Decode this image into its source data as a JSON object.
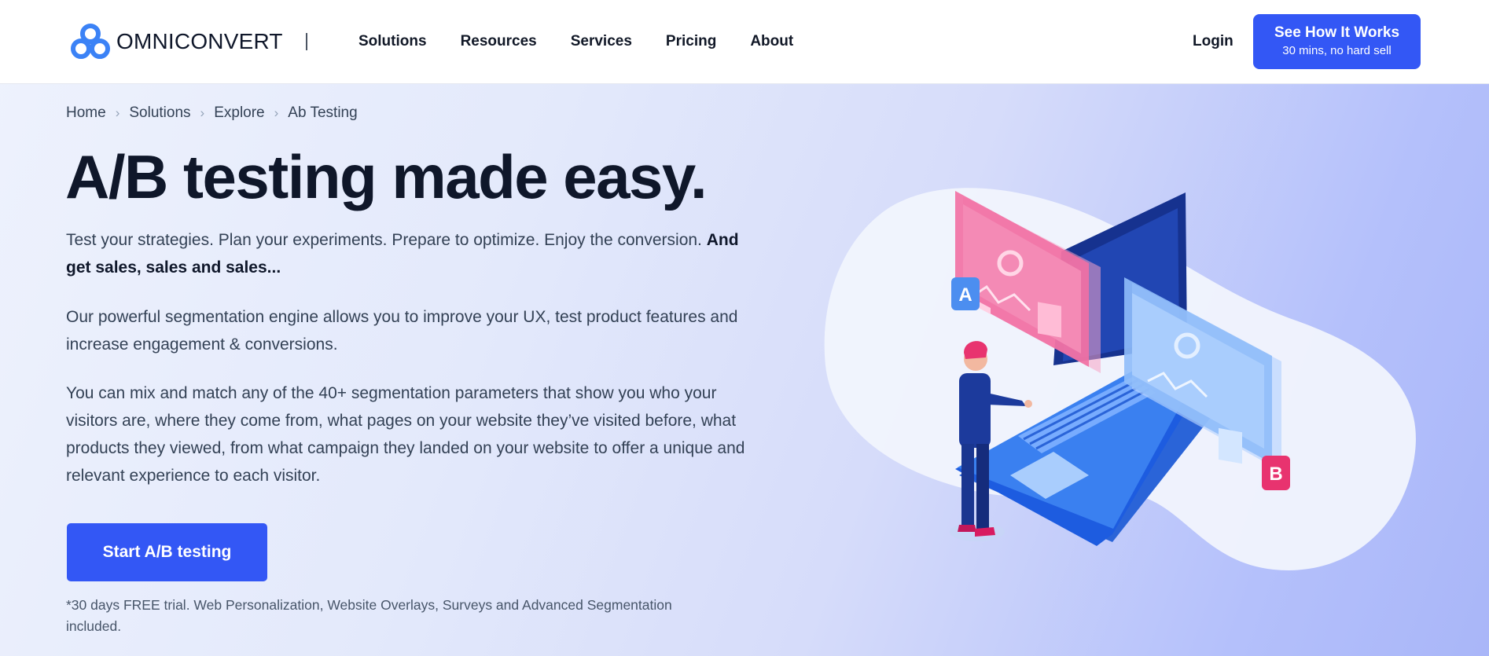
{
  "header": {
    "logo_text": "OMNICONVERT",
    "nav": [
      "Solutions",
      "Resources",
      "Services",
      "Pricing",
      "About"
    ],
    "login_label": "Login",
    "cta": {
      "title": "See How It Works",
      "subtitle": "30 mins, no hard sell"
    }
  },
  "breadcrumb": [
    "Home",
    "Solutions",
    "Explore",
    "Ab Testing"
  ],
  "hero": {
    "title": "A/B testing made easy.",
    "p1_text": "Test your strategies. Plan your experiments. Prepare to optimize. Enjoy the conversion. ",
    "p1_bold": "And get sales, sales and sales...",
    "p2": "Our powerful segmentation engine allows you to improve your UX, test product features and increase engagement & conversions.",
    "p3": "You can mix and match any of the 40+ segmentation parameters that show you who your visitors are, where they come from, what pages on your website they’ve visited before, what products they viewed, from what campaign they landed on your website to offer a unique and relevant experience to each visitor.",
    "cta_label": "Start A/B testing",
    "note": "*30 days FREE trial. Web Personalization, Website Overlays, Surveys and Advanced Segmentation included."
  },
  "illustration": {
    "badge_a": "A",
    "badge_b": "B"
  },
  "colors": {
    "accent": "#3357f5",
    "logo": "#3b82f6",
    "pink": "#f0609a",
    "laptop": "#1f6fe5"
  },
  "icons": [
    "omniconvert-logo-icon",
    "chevron-right-icon"
  ]
}
